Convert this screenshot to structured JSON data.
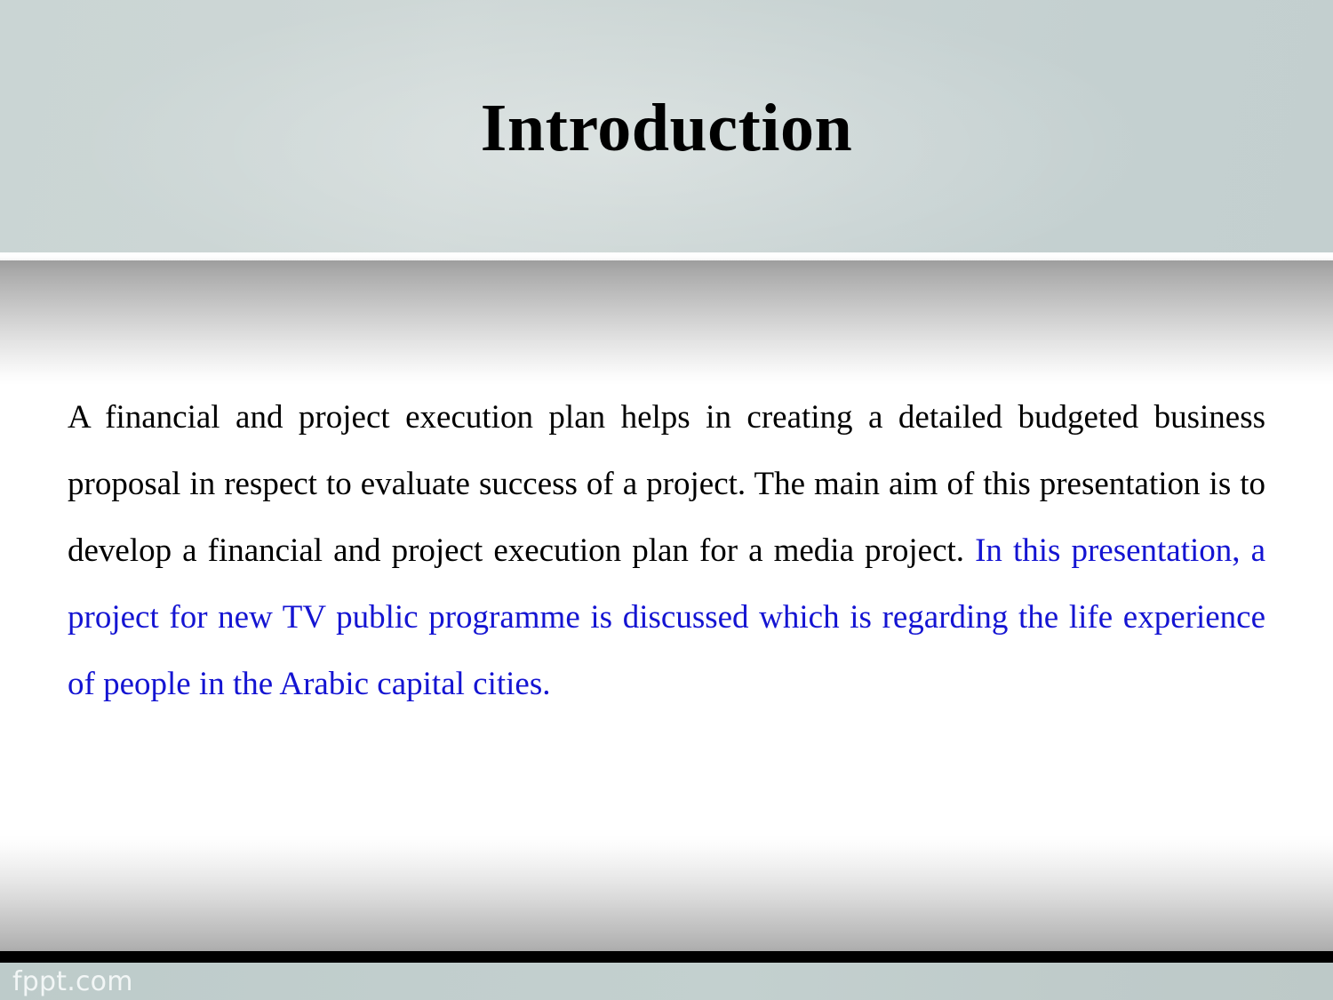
{
  "slide": {
    "title": "Introduction",
    "body": [
      {
        "id": "segment-black",
        "color": "#000000",
        "text": "A financial and project execution plan helps in creating a detailed budgeted business proposal in respect to evaluate success of a project. The main aim of this presentation is to develop a financial and project execution plan for a media project. "
      },
      {
        "id": "segment-blue",
        "color": "#1414d2",
        "text": "In this presentation, a project for new TV public programme is discussed which is regarding the life experience of people in the Arabic capital cities."
      }
    ],
    "footer": {
      "watermark": "fppt.com"
    },
    "colors": {
      "header_band": "#ccd6d5",
      "title_text": "#000000",
      "body_black": "#000000",
      "body_blue": "#1414d2",
      "divider_bar": "#000000",
      "footer_band": "#c1cecd",
      "footer_text": "#f2f6f6",
      "slide_background": "#ffffff"
    }
  }
}
